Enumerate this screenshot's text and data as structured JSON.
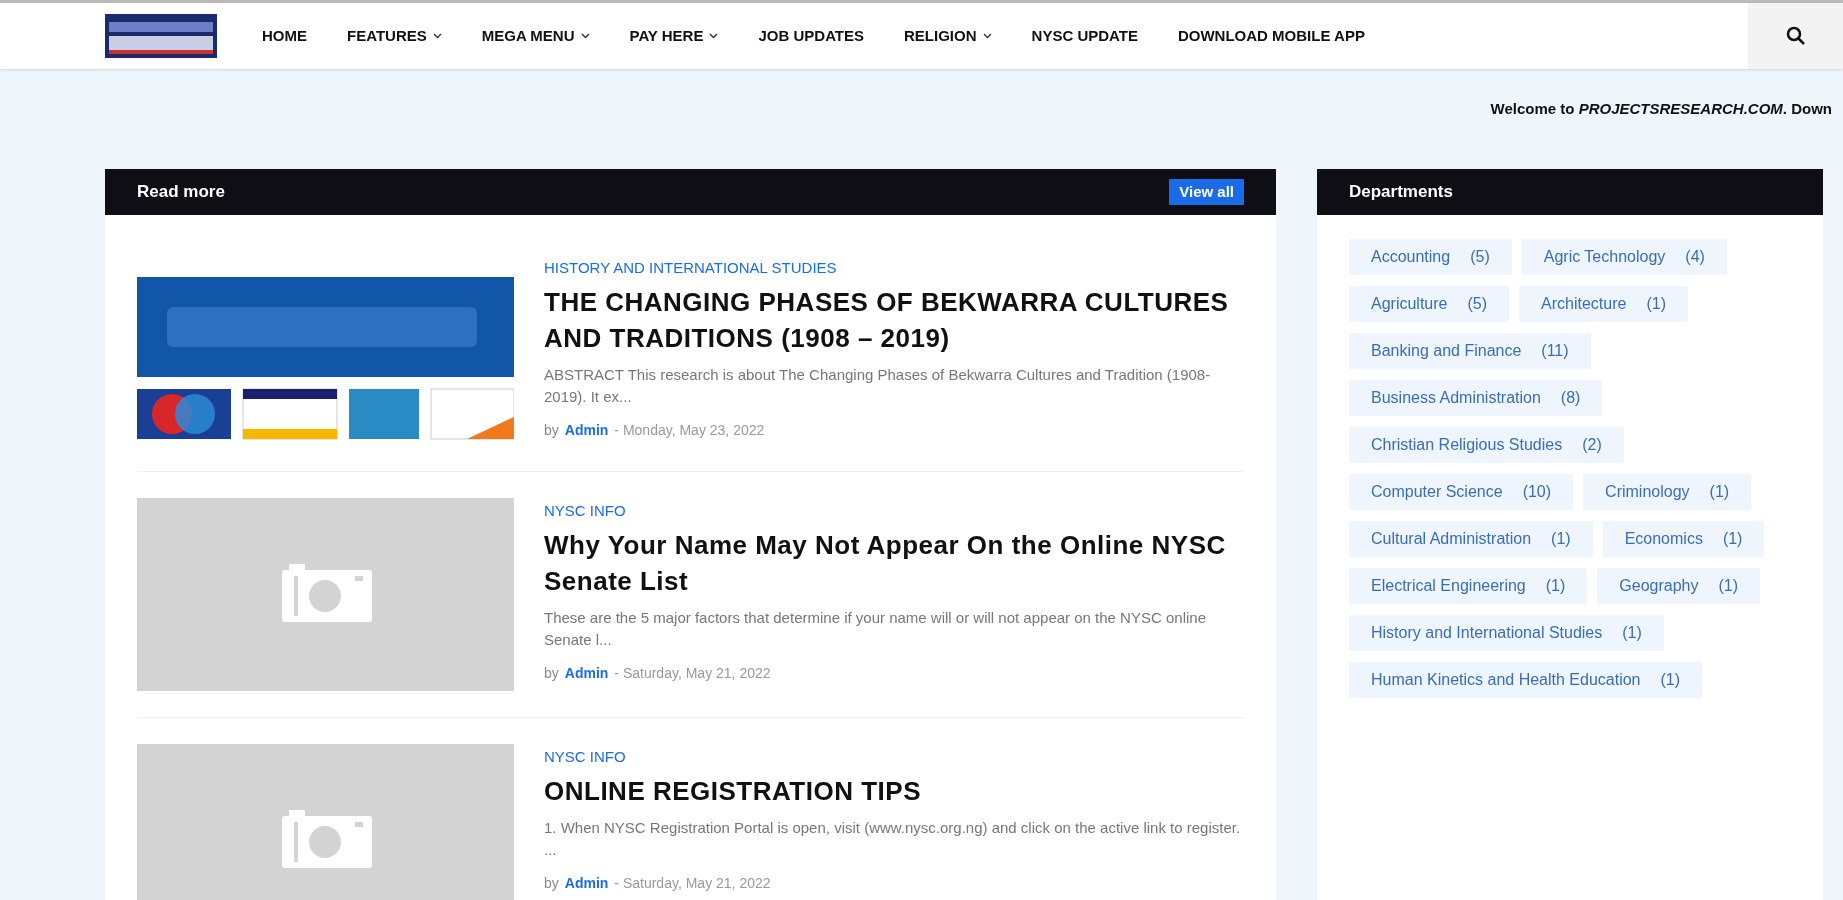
{
  "nav": {
    "items": [
      {
        "label": "HOME",
        "dropdown": false
      },
      {
        "label": "FEATURES",
        "dropdown": true
      },
      {
        "label": "MEGA MENU",
        "dropdown": true
      },
      {
        "label": "PAY HERE",
        "dropdown": true
      },
      {
        "label": "JOB UPDATES",
        "dropdown": false
      },
      {
        "label": "RELIGION",
        "dropdown": true
      },
      {
        "label": "NYSC UPDATE",
        "dropdown": false
      },
      {
        "label": "DOWNLOAD MOBILE APP",
        "dropdown": false
      }
    ]
  },
  "ticker": "Welcome to *PROJECTSRESEARCH.COM*. Down",
  "read_more": {
    "title": "Read more",
    "view_all": "View all",
    "posts": [
      {
        "kind": "payment",
        "category": "HISTORY AND INTERNATIONAL STUDIES",
        "title": "THE CHANGING PHASES OF BEKWARRA CULTURES AND TRADITIONS (1908 – 2019)",
        "excerpt": "ABSTRACT This research is about The Changing Phases of Bekwarra Cultures and Tradition (1908-2019). It ex...",
        "by": "by",
        "author": "Admin",
        "date": "- Monday, May 23, 2022"
      },
      {
        "kind": "placeholder",
        "category": "NYSC INFO",
        "title": "Why Your Name May Not Appear On the Online NYSC Senate List",
        "excerpt": "These are the 5 major factors that determine if your name will or will not appear on the NYSC online Senate l...",
        "by": "by",
        "author": "Admin",
        "date": "- Saturday, May 21, 2022"
      },
      {
        "kind": "placeholder",
        "category": "NYSC INFO",
        "title": "ONLINE REGISTRATION TIPS",
        "excerpt": "1. When NYSC Registration Portal is open, visit (www.nysc.org.ng) and click on the active link to register. ...",
        "by": "by",
        "author": "Admin",
        "date": "- Saturday, May 21, 2022"
      }
    ]
  },
  "departments": {
    "title": "Departments",
    "items": [
      {
        "name": "Accounting",
        "count": "(5)"
      },
      {
        "name": "Agric Technology",
        "count": "(4)"
      },
      {
        "name": "Agriculture",
        "count": "(5)"
      },
      {
        "name": "Architecture",
        "count": "(1)"
      },
      {
        "name": "Banking and Finance",
        "count": "(11)"
      },
      {
        "name": "Business Administration",
        "count": "(8)"
      },
      {
        "name": "Christian Religious Studies",
        "count": "(2)"
      },
      {
        "name": "Computer Science",
        "count": "(10)"
      },
      {
        "name": "Criminology",
        "count": "(1)"
      },
      {
        "name": "Cultural Administration",
        "count": "(1)"
      },
      {
        "name": "Economics",
        "count": "(1)"
      },
      {
        "name": "Electrical Engineering",
        "count": "(1)"
      },
      {
        "name": "Geography",
        "count": "(1)"
      },
      {
        "name": "History and International Studies",
        "count": "(1)"
      },
      {
        "name": "Human Kinetics and Health Education",
        "count": "(1)"
      }
    ]
  }
}
